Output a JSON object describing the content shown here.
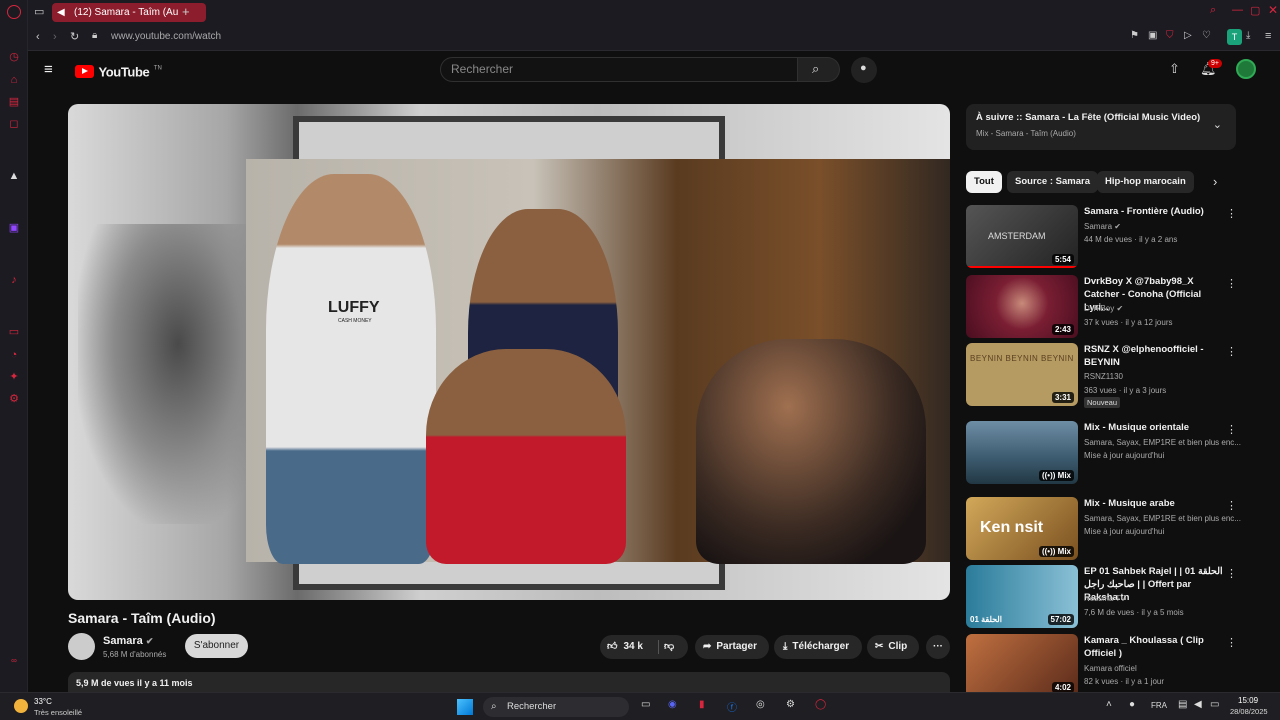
{
  "browser": {
    "tab_title": "(12) Samara - Taîm (Au",
    "url": "www.youtube.com/watch",
    "profile_letter": "T"
  },
  "youtube": {
    "logo": "YouTube",
    "logo_sup": "TN",
    "search_placeholder": "Rechercher",
    "notif_count": "9+"
  },
  "video": {
    "title": "Samara - Taîm (Audio)",
    "channel": "Samara",
    "subscribers": "5,68 M d'abonnés",
    "subscribe": "S'abonner",
    "likes": "34 k",
    "share": "Partager",
    "download": "Télécharger",
    "clip": "Clip",
    "more": "···",
    "stats": "5,9 M de vues  il y a 11 mois",
    "jersey_text": "LUFFY",
    "jersey_sub": "CASH MONEY"
  },
  "up_next": {
    "title": "À suivre :: Samara - La Fête (Official Music Video)",
    "subtitle": "Mix - Samara - Taîm (Audio)"
  },
  "chips": [
    "Tout",
    "Source : Samara",
    "Hip-hop marocain"
  ],
  "recommendations": [
    {
      "title": "Samara - Frontière (Audio)",
      "channel": "Samara",
      "meta": "44 M de vues · il y a 2 ans",
      "duration": "5:54",
      "thumb_text": "AMSTERDAM",
      "color": "#3a3a3a"
    },
    {
      "title": "DvrkBoy X @7baby98_X Catcher - Conoha (Official Lyri...",
      "channel": "DvrkBoy",
      "meta": "37 k vues · il y a 12 jours",
      "duration": "2:43",
      "thumb_text": "",
      "color": "#7a1e33"
    },
    {
      "title": "RSNZ X @elphenoofficiel - BEYNIN",
      "channel": "RSNZ1130",
      "meta": "363 vues · il y a 3 jours",
      "duration": "3:31",
      "badge": "Nouveau",
      "thumb_text": "BEYNIN BEYNIN BEYNIN",
      "color": "#b59a62"
    },
    {
      "title": "Mix - Musique orientale",
      "channel": "Samara, Sayax, EMP1RE et bien plus enc...",
      "meta": "Mise à jour aujourd'hui",
      "duration": "Mix",
      "thumb_text": "",
      "color": "#3c5a6e"
    },
    {
      "title": "Mix - Musique arabe",
      "channel": "Samara, Sayax, EMP1RE et bien plus enc...",
      "meta": "Mise à jour aujourd'hui",
      "duration": "Mix",
      "thumb_text": "Ken nsit",
      "color": "#a5782e"
    },
    {
      "title": "EP 01 Sahbek Rajel | | 01 الحلقة | صاحبك راجل | Offert par Raksha.tn",
      "channel": "Nessma TV",
      "meta": "7,6 M de vues · il y a 5 mois",
      "duration": "57:02",
      "thumb_text": "01 الحلقة",
      "color": "#2a7c9a"
    },
    {
      "title": "Kamara _ Khoulassa ( Clip Officiel )",
      "channel": "Kamara officiel",
      "meta": "82 k vues · il y a 1 jour",
      "duration": "4:02",
      "thumb_text": "",
      "color": "#8a4a2a"
    }
  ],
  "taskbar": {
    "temperature": "33°C",
    "weather": "Très ensoleillé",
    "search": "Rechercher",
    "lang": "FRA",
    "time": "15:09",
    "date": "28/08/2025"
  }
}
